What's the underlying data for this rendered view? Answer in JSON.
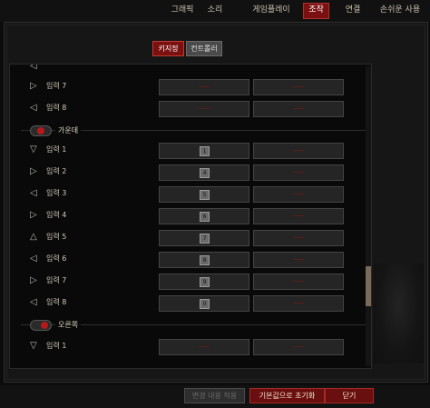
{
  "tabs": [
    {
      "label": "그래픽"
    },
    {
      "label": "소리"
    },
    {
      "label": "게임플레이"
    },
    {
      "label": "조작"
    },
    {
      "label": "연결"
    },
    {
      "label": "손쉬운 사용"
    }
  ],
  "subtabs": {
    "keyboard": "키지정",
    "controller": "컨트롤러"
  },
  "rows_top": [
    {
      "label": "입력 7",
      "icon": "▷"
    },
    {
      "label": "입력 8",
      "icon": "◁"
    }
  ],
  "section_center": {
    "title": "가운데"
  },
  "rows_center": [
    {
      "label": "입력 1",
      "icon": "▽",
      "key": "1"
    },
    {
      "label": "입력 2",
      "icon": "▷",
      "key": "4"
    },
    {
      "label": "입력 3",
      "icon": "◁",
      "key": "5"
    },
    {
      "label": "입력 4",
      "icon": "▷",
      "key": "6"
    },
    {
      "label": "입력 5",
      "icon": "△",
      "key": "7"
    },
    {
      "label": "입력 6",
      "icon": "◁",
      "key": "8"
    },
    {
      "label": "입력 7",
      "icon": "▷",
      "key": "9"
    },
    {
      "label": "입력 8",
      "icon": "◁",
      "key": "0"
    }
  ],
  "section_right": {
    "title": "오른쪽"
  },
  "rows_right": [
    {
      "label": "입력 1",
      "icon": "▽"
    }
  ],
  "buttons": {
    "disabled": "변경 내용 적용",
    "reset": "기본값으로 초기화",
    "close": "닫기"
  }
}
